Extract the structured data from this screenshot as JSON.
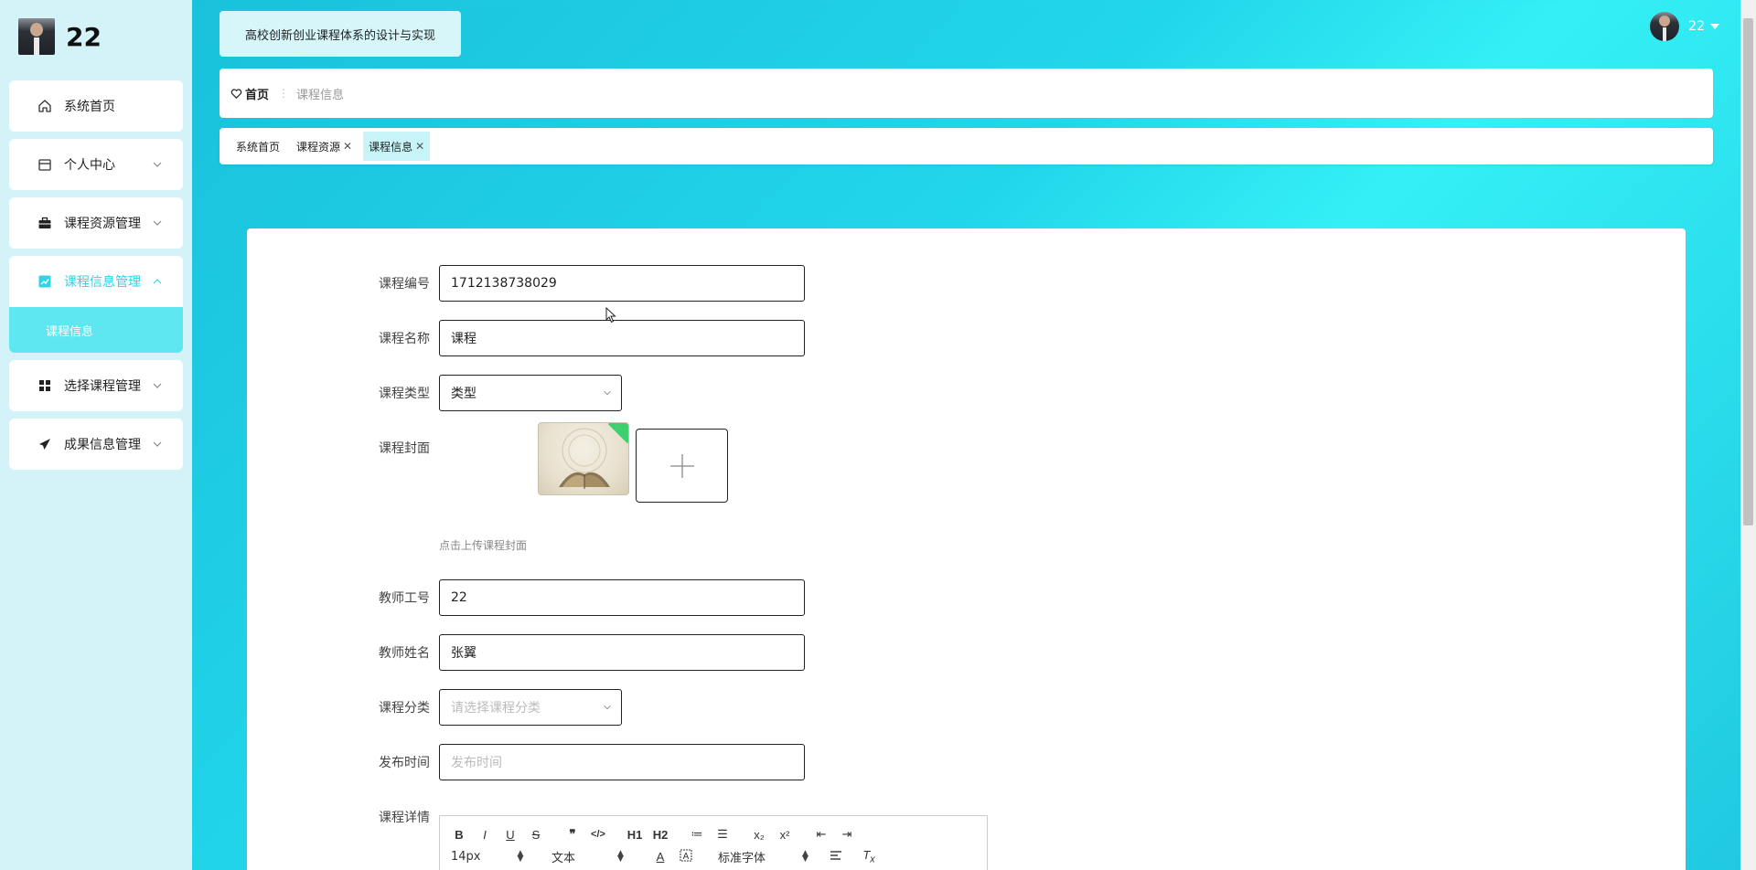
{
  "brand": {
    "name": "22"
  },
  "sidebar": {
    "items": [
      {
        "label": "系统首页",
        "icon": "home-icon"
      },
      {
        "label": "个人中心",
        "icon": "calendar-icon"
      },
      {
        "label": "课程资源管理",
        "icon": "briefcase-icon"
      },
      {
        "label": "课程信息管理",
        "icon": "chart-icon",
        "active": true
      },
      {
        "label": "选择课程管理",
        "icon": "grid-icon"
      },
      {
        "label": "成果信息管理",
        "icon": "send-icon"
      }
    ],
    "submenu": {
      "label": "课程信息"
    }
  },
  "header": {
    "title": "高校创新创业课程体系的设计与实现",
    "user": "22"
  },
  "breadcrumb": {
    "home": "首页",
    "separator": "⋮",
    "current": "课程信息"
  },
  "tabs": [
    {
      "label": "系统首页",
      "closable": false
    },
    {
      "label": "课程资源",
      "closable": true
    },
    {
      "label": "课程信息",
      "closable": true,
      "active": true
    }
  ],
  "form": {
    "course_no": {
      "label": "课程编号",
      "value": "1712138738029"
    },
    "course_name": {
      "label": "课程名称",
      "value": "课程"
    },
    "course_type": {
      "label": "课程类型",
      "value": "类型"
    },
    "cover": {
      "label": "课程封面",
      "hint": "点击上传课程封面"
    },
    "teacher_no": {
      "label": "教师工号",
      "value": "22"
    },
    "teacher_name": {
      "label": "教师姓名",
      "value": "张翼"
    },
    "category": {
      "label": "课程分类",
      "placeholder": "请选择课程分类"
    },
    "publish_time": {
      "label": "发布时间",
      "placeholder": "发布时间"
    },
    "detail": {
      "label": "课程详情"
    }
  },
  "editor": {
    "row1": [
      "B",
      "I",
      "U",
      "S",
      "❞",
      "</>",
      "H1",
      "H2",
      "≔",
      "☰",
      "x₂",
      "x²",
      "⇤",
      "⇥"
    ],
    "font_size": "14px",
    "block_type": "文本",
    "font_family": "标准字体"
  },
  "colors": {
    "accent": "#2fd3e6",
    "sidebar_bg": "#d3f3f8",
    "submenu_bg": "#5ee6f1"
  }
}
